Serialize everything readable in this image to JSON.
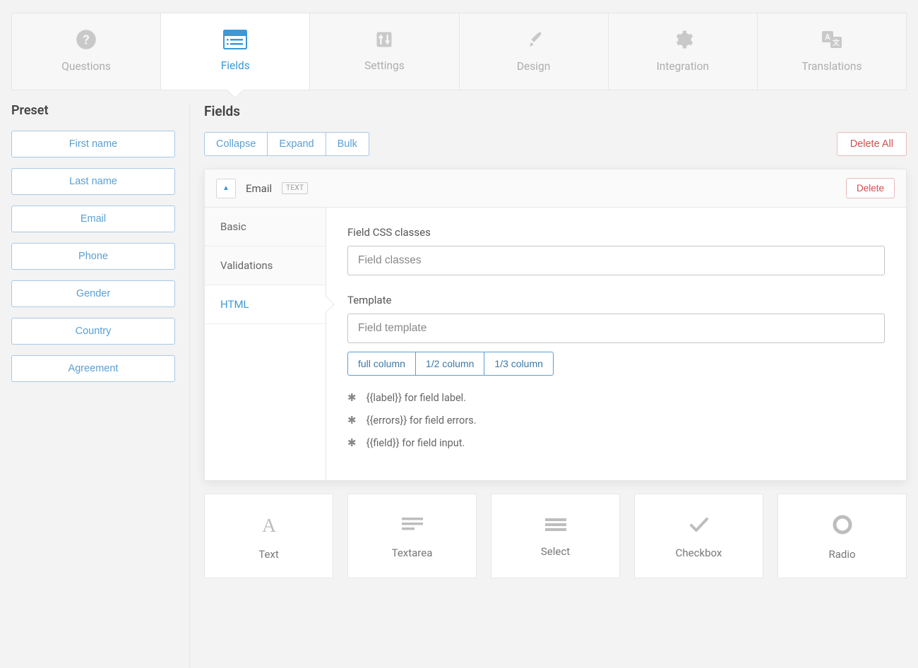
{
  "top_tabs": {
    "questions": "Questions",
    "fields": "Fields",
    "settings": "Settings",
    "design": "Design",
    "integration": "Integration",
    "translations": "Translations"
  },
  "active_top_tab": "fields",
  "sidebar": {
    "title": "Preset",
    "items": [
      "First name",
      "Last name",
      "Email",
      "Phone",
      "Gender",
      "Country",
      "Agreement"
    ]
  },
  "content": {
    "title": "Fields",
    "toolbar": {
      "collapse": "Collapse",
      "expand": "Expand",
      "bulk": "Bulk",
      "delete_all": "Delete All"
    }
  },
  "field": {
    "name": "Email",
    "type_badge": "TEXT",
    "delete": "Delete",
    "sub_tabs": {
      "basic": "Basic",
      "validations": "Validations",
      "html": "HTML"
    },
    "active_sub_tab": "html",
    "html_pane": {
      "css_label": "Field CSS classes",
      "css_placeholder": "Field classes",
      "template_label": "Template",
      "template_placeholder": "Field template",
      "col_buttons": {
        "full": "full column",
        "half": "1/2 column",
        "third": "1/3 column"
      },
      "hints": [
        "{{label}} for field label.",
        "{{errors}} for field errors.",
        "{{field}} for field input."
      ]
    }
  },
  "field_types": {
    "text": "Text",
    "textarea": "Textarea",
    "select": "Select",
    "checkbox": "Checkbox",
    "radio": "Radio"
  }
}
